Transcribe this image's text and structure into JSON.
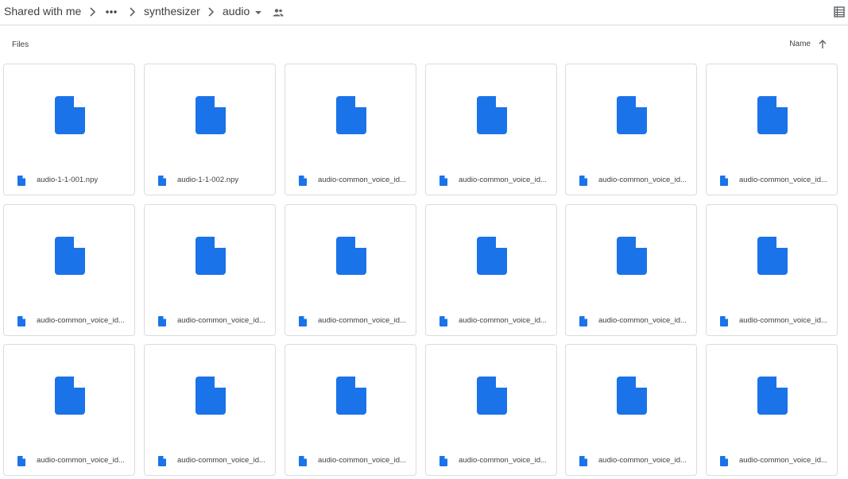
{
  "breadcrumb": {
    "root": "Shared with me",
    "folder1": "synthesizer",
    "current": "audio"
  },
  "icons": {
    "more": "more-horiz-icon",
    "separator": "chevron-right-icon",
    "dropdown": "arrow-drop-down-icon",
    "shared": "people-icon",
    "view": "list-view-icon",
    "sort": "arrow-upward-icon",
    "file": "file-icon"
  },
  "colors": {
    "file_blue": "#1a73e8",
    "text": "#3c4043",
    "border": "#dadce0"
  },
  "section": {
    "title": "Files"
  },
  "sort": {
    "label": "Name"
  },
  "files": [
    "audio-1-1-001.npy",
    "audio-1-1-002.npy",
    "audio-common_voice_id...",
    "audio-common_voice_id...",
    "audio-common_voice_id...",
    "audio-common_voice_id...",
    "audio-common_voice_id...",
    "audio-common_voice_id...",
    "audio-common_voice_id...",
    "audio-common_voice_id...",
    "audio-common_voice_id...",
    "audio-common_voice_id...",
    "audio-common_voice_id...",
    "audio-common_voice_id...",
    "audio-common_voice_id...",
    "audio-common_voice_id...",
    "audio-common_voice_id...",
    "audio-common_voice_id..."
  ]
}
